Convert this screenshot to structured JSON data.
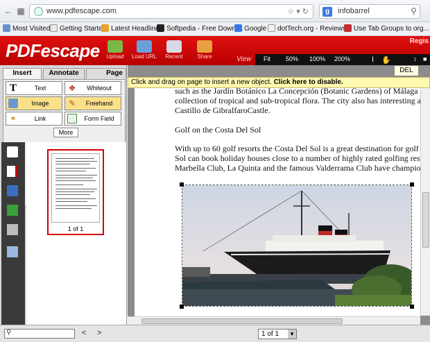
{
  "browser": {
    "url": "www.pdfescape.com",
    "search_engine_icon": "google-g-icon",
    "search_value": "infobarrel"
  },
  "bookmarks": [
    {
      "label": "Most Visited",
      "icon": "star-icon",
      "color": "#6a8fd0"
    },
    {
      "label": "Getting Started",
      "icon": "page-icon",
      "color": "#e8e8e8"
    },
    {
      "label": "Latest Headlines",
      "icon": "rss-icon",
      "color": "#e8a030"
    },
    {
      "label": "Softpedia - Free Downl...",
      "icon": "softpedia-icon",
      "color": "#222222"
    },
    {
      "label": "Google",
      "icon": "google-icon",
      "color": "#3b78e7"
    },
    {
      "label": "dotTech.org - Reviews...",
      "icon": "dottech-icon",
      "color": "#f0f0f0"
    },
    {
      "label": "Use Tab Groups to org...",
      "icon": "puzzle-icon",
      "color": "#c03030"
    }
  ],
  "app": {
    "logo": "PDFescape",
    "register_label": "Regis",
    "tools": [
      {
        "label": "Upload",
        "icon": "upload-icon"
      },
      {
        "label": "Load URL",
        "icon": "load-url-icon"
      },
      {
        "label": "Recent",
        "icon": "recent-icon"
      },
      {
        "label": "Share",
        "icon": "share-icon"
      }
    ],
    "view_label": "View",
    "zoom_options": [
      "Fit",
      "50%",
      "100%",
      "200%"
    ]
  },
  "sidebar": {
    "tabs": [
      "Insert",
      "Annotate",
      "Page"
    ],
    "tool_buttons": [
      {
        "label": "Text",
        "icon": "text-icon",
        "selected": false
      },
      {
        "label": "Whiteout",
        "icon": "whiteout-icon",
        "selected": false
      },
      {
        "label": "Image",
        "icon": "image-icon",
        "selected": true
      },
      {
        "label": "Freehand",
        "icon": "freehand-icon",
        "selected": true
      },
      {
        "label": "Link",
        "icon": "link-icon",
        "selected": false
      },
      {
        "label": "Form Field",
        "icon": "form-field-icon",
        "selected": false
      }
    ],
    "more_label": "More",
    "strip_icons": [
      "pages-icon",
      "pdf-icon",
      "save-icon",
      "download-icon",
      "print-icon",
      "window-icon"
    ],
    "thumb_label": "1 of 1"
  },
  "document": {
    "del_label": "DEL",
    "hint_text": "Click and drag on page to insert a new object.",
    "hint_bold": "Click here to disable.",
    "lines": [
      "such as the Jardín Botánico La Concepción (Botanic Gardens) of Málaga",
      "collection of tropical and sub-tropical flora. The city also has interesting a",
      "Castillo de GibralfaroCastle.",
      "Golf on the Costa Del Sol",
      "With up to 60 golf resorts the Costa Del Sol is a great destination for golf",
      "Sol can book holiday houses close to a number of highly rated golfing res",
      "Marbella Club, La Quinta and the famous Valderrama Club have champio"
    ],
    "image_icon": "ship-photo"
  },
  "footer": {
    "page_select": "1 of 1",
    "prev": "<",
    "next": ">"
  }
}
